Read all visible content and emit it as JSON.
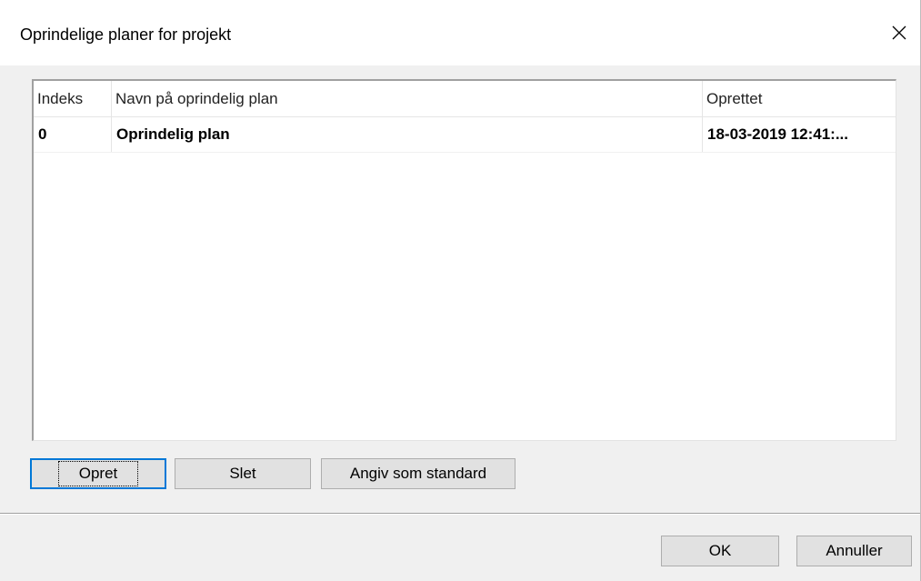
{
  "dialog": {
    "title": "Oprindelige planer for projekt",
    "close_icon": "close-icon"
  },
  "list": {
    "columns": [
      "Indeks",
      "Navn på oprindelig plan",
      "Oprettet"
    ],
    "rows": [
      {
        "index": "0",
        "name": "Oprindelig plan",
        "created": "18-03-2019 12:41:..."
      }
    ]
  },
  "actions": {
    "create_label": "Opret",
    "delete_label": "Slet",
    "set_default_label": "Angiv som standard"
  },
  "footer": {
    "ok_label": "OK",
    "cancel_label": "Annuller"
  },
  "colors": {
    "focus_border": "#0078d7",
    "button_face": "#e1e1e1",
    "dialog_bg": "#f0f0f0"
  }
}
